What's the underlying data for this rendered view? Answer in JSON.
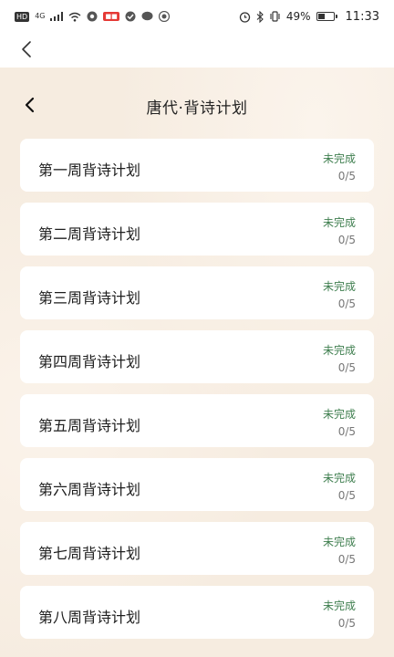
{
  "status_bar": {
    "left_icons": [
      "HD",
      "4G",
      "signal-icon",
      "wifi-icon",
      "app-icon",
      "red-badge",
      "check-icon",
      "chat-icon",
      "app-icon"
    ],
    "network": "4G",
    "hd": "HD",
    "battery_percent": "49%",
    "battery_level": 0.49,
    "time": "11:33"
  },
  "nav": {
    "back_icon": "chevron-left-icon"
  },
  "header": {
    "title": "唐代·背诗计划"
  },
  "plans": [
    {
      "name": "第一周背诗计划",
      "status": "未完成",
      "progress": "0/5"
    },
    {
      "name": "第二周背诗计划",
      "status": "未完成",
      "progress": "0/5"
    },
    {
      "name": "第三周背诗计划",
      "status": "未完成",
      "progress": "0/5"
    },
    {
      "name": "第四周背诗计划",
      "status": "未完成",
      "progress": "0/5"
    },
    {
      "name": "第五周背诗计划",
      "status": "未完成",
      "progress": "0/5"
    },
    {
      "name": "第六周背诗计划",
      "status": "未完成",
      "progress": "0/5"
    },
    {
      "name": "第七周背诗计划",
      "status": "未完成",
      "progress": "0/5"
    },
    {
      "name": "第八周背诗计划",
      "status": "未完成",
      "progress": "0/5"
    }
  ],
  "colors": {
    "status_green": "#3e7e4e",
    "background": "#f6ece0"
  }
}
